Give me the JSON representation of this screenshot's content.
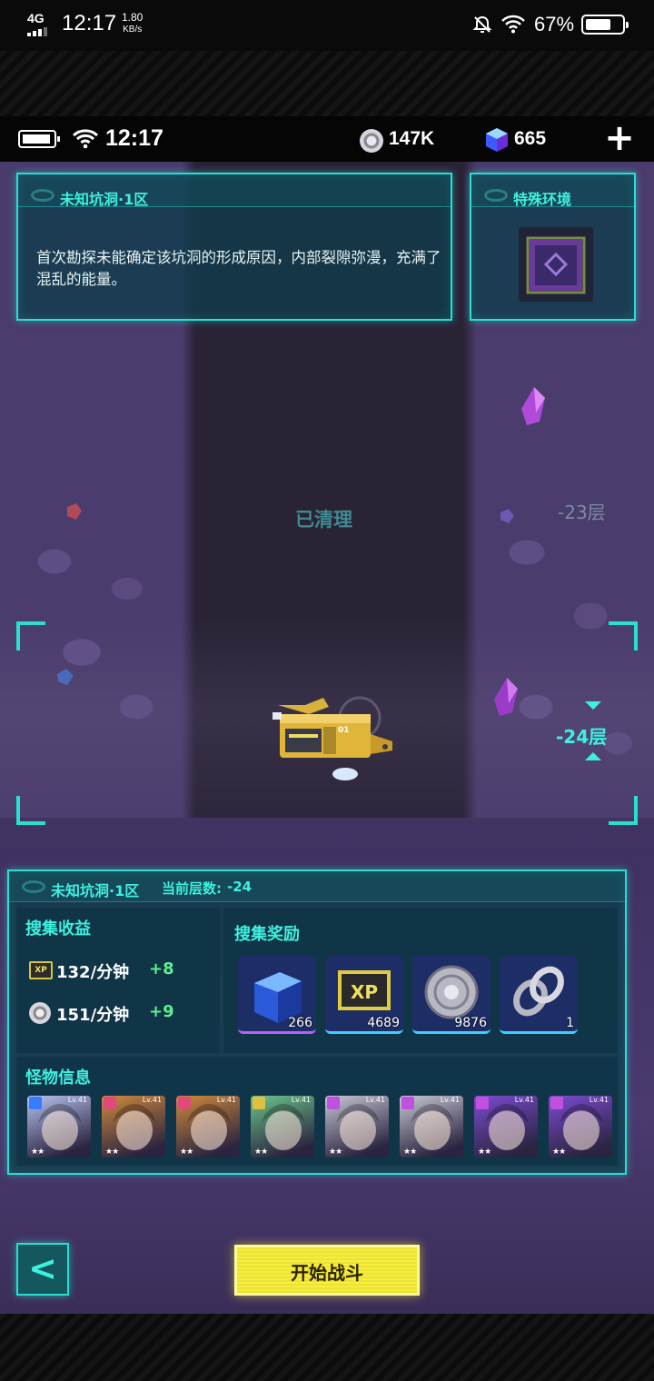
{
  "status_bar": {
    "network": "4G",
    "time": "12:17",
    "speed_value": "1.80",
    "speed_unit": "KB/s",
    "battery_percent": "67%",
    "battery_level": 0.67,
    "icons": [
      "signal-icon",
      "silent-bell-icon",
      "wifi-icon",
      "battery-icon"
    ]
  },
  "game_header": {
    "time": "12:17",
    "coins": "147K",
    "gems": "665",
    "plus_label": "+"
  },
  "zone_panel": {
    "title": "未知坑洞·1区",
    "description": "首次勘探未能确定该坑洞的形成原因，内部裂隙弥漫，充满了混乱的能量。"
  },
  "env_panel": {
    "title": "特殊环境"
  },
  "world": {
    "cleared_label": "已清理",
    "upper_floor": "-23层",
    "current_floor": "-24层",
    "ship_number": "01"
  },
  "info_panel": {
    "title": "未知坑洞·1区",
    "floor_label": "当前层数:",
    "floor_value": "-24",
    "income_title": "搜集收益",
    "income": [
      {
        "icon": "xp-chip-icon",
        "icon_text": "XP",
        "rate": "132/分钟",
        "bonus": "+8"
      },
      {
        "icon": "coin-icon",
        "rate": "151/分钟",
        "bonus": "+9"
      }
    ],
    "rewards_title": "搜集奖励",
    "rewards": [
      {
        "icon": "blue-cube-icon",
        "count": "266"
      },
      {
        "icon": "xp-chip-icon",
        "icon_text": "XP",
        "count": "4689"
      },
      {
        "icon": "silver-coin-icon",
        "count": "9876"
      },
      {
        "icon": "chain-link-icon",
        "count": "1"
      }
    ],
    "monster_title": "怪物信息",
    "monsters": [
      {
        "level": "Lv.41",
        "stars": "★★",
        "color": "#b8c4f0",
        "badge": "#3a7cff"
      },
      {
        "level": "Lv.41",
        "stars": "★★",
        "color": "#d08a3c",
        "badge": "#e04a7a"
      },
      {
        "level": "Lv.41",
        "stars": "★★",
        "color": "#d08a3c",
        "badge": "#e04a7a"
      },
      {
        "level": "Lv.41",
        "stars": "★★",
        "color": "#6cc48a",
        "badge": "#e0c040"
      },
      {
        "level": "Lv.41",
        "stars": "★★",
        "color": "#c8c8d4",
        "badge": "#c050e0"
      },
      {
        "level": "Lv.41",
        "stars": "★★",
        "color": "#c8c8d4",
        "badge": "#c050e0"
      },
      {
        "level": "Lv.41",
        "stars": "★★",
        "color": "#7c4cd0",
        "badge": "#c050e0"
      },
      {
        "level": "Lv.41",
        "stars": "★★",
        "color": "#7c4cd0",
        "badge": "#c050e0"
      }
    ]
  },
  "controls": {
    "back_label": "<",
    "start_label": "开始战斗"
  },
  "colors": {
    "accent": "#27e0d2",
    "button": "#f6ee3a",
    "rock": "#4a3c6c",
    "bonus": "#5cf08c"
  }
}
